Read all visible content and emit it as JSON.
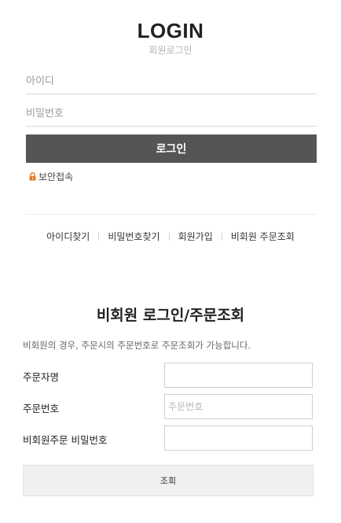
{
  "login": {
    "title": "LOGIN",
    "subtitle": "회원로그인",
    "id_placeholder": "아이디",
    "password_placeholder": "비밀번호",
    "login_button": "로그인",
    "secure_label": "보안접속",
    "secure_icon": "lock-icon",
    "accent_color": "#e8771e"
  },
  "links": {
    "find_id": "아이디찾기",
    "find_password": "비밀번호찾기",
    "signup": "회원가입",
    "guest_order_lookup": "비회원 주문조회"
  },
  "guest": {
    "title": "비회원 로그인/주문조회",
    "description": "비회원의 경우, 주문시의 주문번호로 주문조회가 가능합니다.",
    "orderer_name_label": "주문자명",
    "order_number_label": "주문번호",
    "order_number_placeholder": "주문번호",
    "order_password_label": "비회원주문 비밀번호",
    "lookup_button": "조회"
  }
}
